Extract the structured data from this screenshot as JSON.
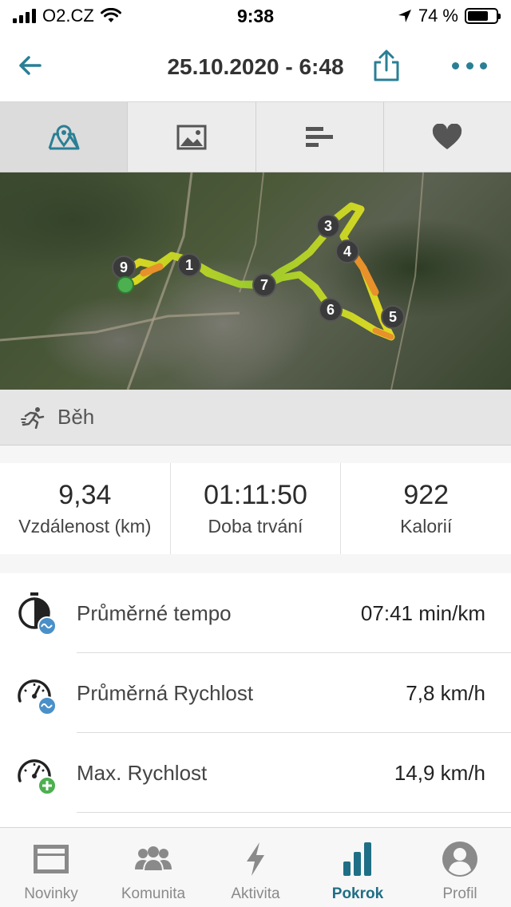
{
  "status_bar": {
    "carrier": "O2.CZ",
    "time": "9:38",
    "battery": "74 %",
    "battery_level": 0.74
  },
  "header": {
    "title": "25.10.2020 - 6:48"
  },
  "tabs": [
    {
      "icon": "map-icon",
      "active": true
    },
    {
      "icon": "image-icon",
      "active": false
    },
    {
      "icon": "bars-icon",
      "active": false
    },
    {
      "icon": "heart-icon",
      "active": false
    }
  ],
  "map": {
    "markers": [
      "1",
      "3",
      "4",
      "5",
      "6",
      "7",
      "9"
    ]
  },
  "activity": {
    "type": "Běh",
    "icon": "running-icon"
  },
  "summary": [
    {
      "value": "9,34",
      "label": "Vzdálenost (km)"
    },
    {
      "value": "01:11:50",
      "label": "Doba trvání"
    },
    {
      "value": "922",
      "label": "Kalorií"
    }
  ],
  "metrics": [
    {
      "name": "Průměrné tempo",
      "value": "07:41 min/km",
      "icon": "stopwatch-avg-icon"
    },
    {
      "name": "Průměrná Rychlost",
      "value": "7,8 km/h",
      "icon": "speedometer-avg-icon"
    },
    {
      "name": "Max. Rychlost",
      "value": "14,9 km/h",
      "icon": "speedometer-max-icon"
    }
  ],
  "bottom_nav": [
    {
      "label": "Novinky",
      "icon": "news-icon",
      "active": false
    },
    {
      "label": "Komunita",
      "icon": "community-icon",
      "active": false
    },
    {
      "label": "Aktivita",
      "icon": "lightning-icon",
      "active": false
    },
    {
      "label": "Pokrok",
      "icon": "progress-icon",
      "active": true
    },
    {
      "label": "Profil",
      "icon": "profile-icon",
      "active": false
    }
  ],
  "colors": {
    "accent": "#2a7f95",
    "nav_active": "#1e6f85",
    "route_green": "#9ccf2a",
    "route_yellow": "#e8e020",
    "route_orange": "#e8902a"
  }
}
